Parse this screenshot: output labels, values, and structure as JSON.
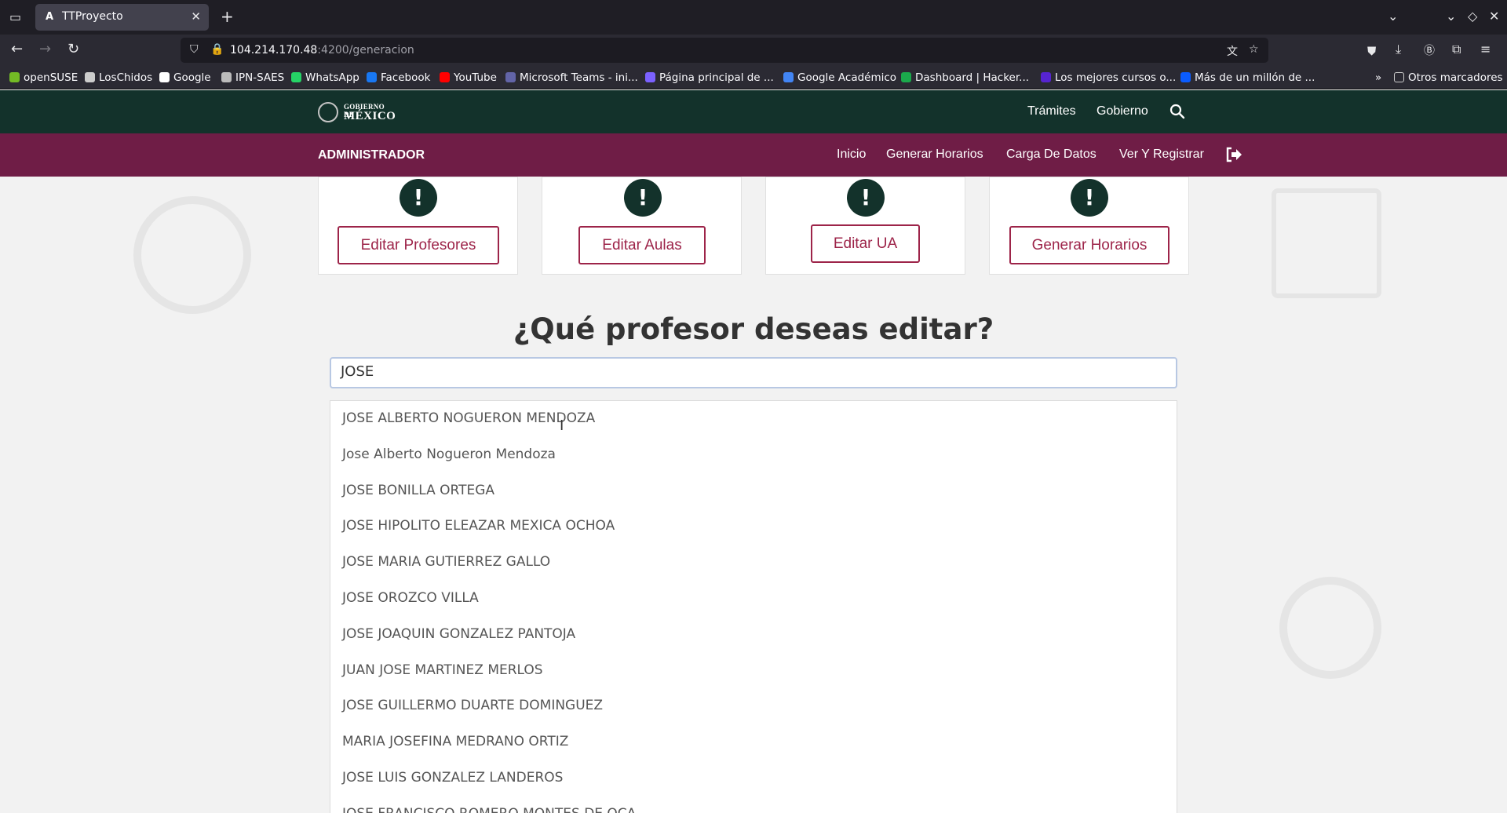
{
  "browser": {
    "tab_title": "TTProyecto",
    "tab_favicon": "A",
    "url_host": "104.214.170.48",
    "url_rest": ":4200/generacion",
    "bookmarks": [
      {
        "label": "openSUSE",
        "color": "#73ba25"
      },
      {
        "label": "LosChidos",
        "color": "#cccccc"
      },
      {
        "label": "Google",
        "color": "#ffffff"
      },
      {
        "label": "IPN-SAES",
        "color": "#bbbbbb"
      },
      {
        "label": "WhatsApp",
        "color": "#25d366"
      },
      {
        "label": "Facebook",
        "color": "#1877f2"
      },
      {
        "label": "YouTube",
        "color": "#ff0000"
      },
      {
        "label": "Microsoft Teams - ini...",
        "color": "#6264a7"
      },
      {
        "label": "Página principal de ...",
        "color": "#7b61ff"
      },
      {
        "label": "Google Académico",
        "color": "#4285f4"
      },
      {
        "label": "Dashboard | Hacker...",
        "color": "#1ba94c"
      },
      {
        "label": "Los mejores cursos o...",
        "color": "#5624d0"
      },
      {
        "label": "Más de un millón de ...",
        "color": "#0a5cff"
      }
    ],
    "other_bookmarks": "Otros marcadores"
  },
  "header": {
    "logo_top": "GOBIERNO DE",
    "logo_main": "MÉXICO",
    "links": [
      "Trámites",
      "Gobierno"
    ]
  },
  "admin_bar": {
    "brand": "ADMINISTRADOR",
    "links": [
      "Inicio",
      "Generar Horarios",
      "Carga De Datos",
      "Ver Y Registrar"
    ]
  },
  "cards": [
    {
      "button": "Editar Profesores"
    },
    {
      "button": "Editar Aulas"
    },
    {
      "button": "Editar UA"
    },
    {
      "button": "Generar Horarios"
    }
  ],
  "main": {
    "heading": "¿Qué profesor deseas editar?",
    "search_value": "JOSE",
    "results": [
      "JOSE ALBERTO NOGUERON MENDOZA",
      "Jose Alberto Nogueron Mendoza",
      "JOSE BONILLA ORTEGA",
      "JOSE HIPOLITO ELEAZAR MEXICA OCHOA",
      "JOSE MARIA GUTIERREZ GALLO",
      "JOSE OROZCO VILLA",
      "JOSE JOAQUIN GONZALEZ PANTOJA",
      "JUAN JOSE MARTINEZ MERLOS",
      "JOSE GUILLERMO DUARTE DOMINGUEZ",
      "MARIA JOSEFINA MEDRANO ORTIZ",
      "JOSE LUIS GONZALEZ LANDEROS",
      "JOSE FRANCISCO ROMERO MONTES DE OCA"
    ]
  },
  "colors": {
    "gov_green": "#13322b",
    "admin_wine": "#6f1d46",
    "accent": "#9d2449"
  }
}
